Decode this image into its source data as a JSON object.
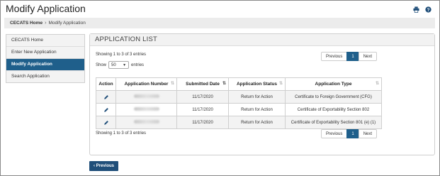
{
  "page": {
    "title": "Modify Application"
  },
  "breadcrumb": {
    "home": "CECATS Home",
    "separator": "›",
    "current": "Modify Application"
  },
  "sidebar": {
    "items": [
      {
        "label": "CECATS Home",
        "active": false
      },
      {
        "label": "Enter New Application",
        "active": false
      },
      {
        "label": "Modify Application",
        "active": true
      },
      {
        "label": "Search Application",
        "active": false
      }
    ]
  },
  "list": {
    "title": "APPLICATION LIST",
    "info_top": "Showing 1 to 3 of 3 entries",
    "info_bottom": "Showing 1 to 3 of 3 entries",
    "show_label": "Show",
    "entries_value": "50",
    "entries_label": "entries",
    "pager": {
      "previous": "Previous",
      "current": "1",
      "next": "Next"
    },
    "columns": [
      "Action",
      "Application Number",
      "Submitted Date",
      "Application Status",
      "Application Type"
    ],
    "rows": [
      {
        "submitted": "11/17/2020",
        "status": "Return for Action",
        "type": "Certificate to Foreign Government (CFG)"
      },
      {
        "submitted": "11/17/2020",
        "status": "Return for Action",
        "type": "Certificate of Exportability Section 802"
      },
      {
        "submitted": "11/17/2020",
        "status": "Return for Action",
        "type": "Certificate of Exportability Section 801 (e) (1)"
      }
    ]
  },
  "footer": {
    "previous_button": "Previous"
  },
  "colors": {
    "accent": "#1f5f8b",
    "button": "#1f4e79"
  },
  "icons": {
    "print": "print-icon",
    "help": "help-icon",
    "edit": "pencil-icon",
    "previous": "chevron-left-icon"
  }
}
